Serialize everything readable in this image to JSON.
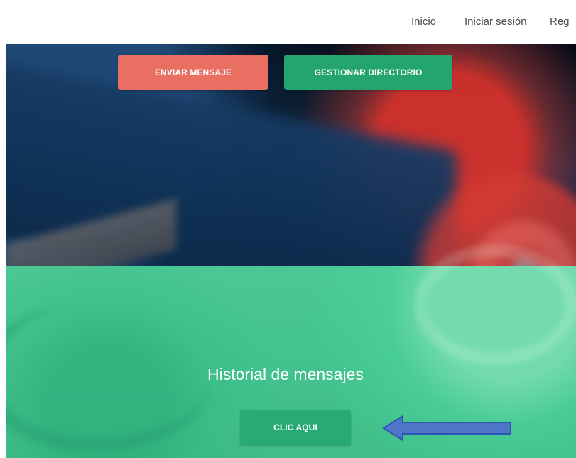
{
  "nav": {
    "items": [
      {
        "label": "Inicio"
      },
      {
        "label": "Iniciar sesión"
      },
      {
        "label": "Reg"
      }
    ]
  },
  "hero": {
    "buttons": {
      "send_message": "ENVIAR MENSAJE",
      "manage_directory": "GESTIONAR DIRECTORIO",
      "click_here": "CLIC AQUI"
    },
    "history_title": "Historial de mensajes"
  },
  "colors": {
    "send_button": "#e96f62",
    "directory_button": "#24a56f",
    "click_button": "#27aa73",
    "dark_background": "#06182a",
    "green_background": "#45c590",
    "arrow_fill": "#4f75c9",
    "arrow_stroke": "#2f55b3"
  },
  "icons": {
    "arrow": "left-arrow-icon"
  }
}
